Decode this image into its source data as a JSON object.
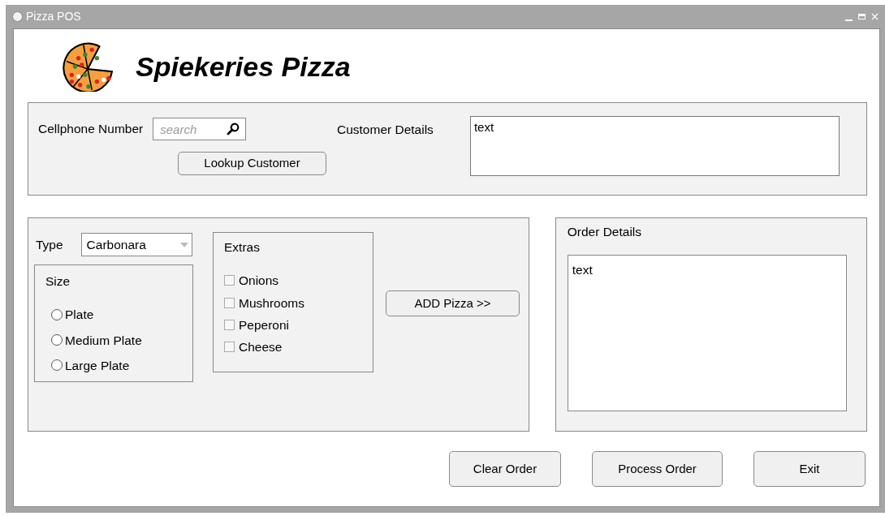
{
  "window": {
    "title": "Pizza POS"
  },
  "header": {
    "title": "Spiekeries Pizza"
  },
  "customer": {
    "phone_label": "Cellphone Number",
    "search": {
      "placeholder": "search"
    },
    "lookup_button": "Lookup Customer",
    "details_label": "Customer Details",
    "details_value": "text"
  },
  "pizza": {
    "type_label": "Type",
    "type_value": "Carbonara",
    "size": {
      "legend": "Size",
      "options": [
        {
          "label": "Plate",
          "selected": false
        },
        {
          "label": "Medium Plate",
          "selected": false
        },
        {
          "label": "Large Plate",
          "selected": false
        }
      ]
    },
    "extras": {
      "legend": "Extras",
      "options": [
        {
          "label": "Onions",
          "checked": false
        },
        {
          "label": "Mushrooms",
          "checked": false
        },
        {
          "label": "Peperoni",
          "checked": false
        },
        {
          "label": "Cheese",
          "checked": false
        }
      ]
    },
    "add_button": "ADD Pizza >>"
  },
  "order": {
    "label": "Order Details",
    "value": "text"
  },
  "buttons": [
    "Clear Order",
    "Process Order",
    "Exit"
  ]
}
